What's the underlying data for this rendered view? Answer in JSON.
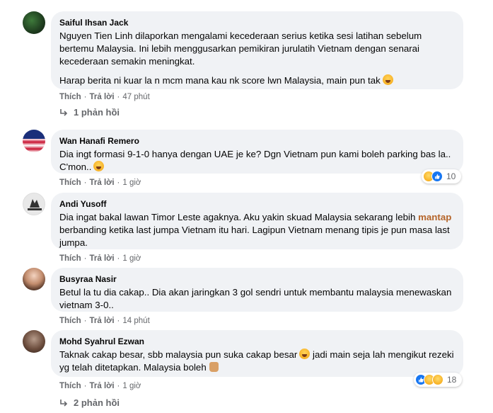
{
  "comments": [
    {
      "author": "Saiful Ihsan Jack",
      "paragraph1": "Nguyen Tien Linh dilaporkan mengalami kecederaan serius ketika sesi latihan sebelum bertemu Malaysia. Ini lebih menggusarkan pemikiran jurulatih Vietnam dengan senarai kecederaan semakin meningkat.",
      "paragraph2": "Harap berita ni kuar la n mcm mana kau nk score lwn Malaysia, main pun tak",
      "like": "Thích",
      "reply": "Trả lời",
      "time": "47 phút",
      "replies": "1 phản hồi"
    },
    {
      "author": "Wan Hanafi Remero",
      "text": "Dia ingt formasi 9-1-0 hanya dengan UAE je ke? Dgn Vietnam pun kami boleh parking bas la.. C'mon..",
      "like": "Thích",
      "reply": "Trả lời",
      "time": "1 giờ",
      "reaction_count": "10"
    },
    {
      "author": "Andi Yusoff",
      "text_before": "Dia ingat bakal lawan Timor Leste agaknya. Aku yakin skuad Malaysia sekarang lebih",
      "highlight": "mantap",
      "text_after": "berbanding ketika last jumpa Vietnam itu hari. Lagipun Vietnam menang tipis je pun masa last jumpa.",
      "like": "Thích",
      "reply": "Trả lời",
      "time": "1 giờ"
    },
    {
      "author": "Busyraa Nasir",
      "text": "Betul la tu dia cakap.. Dia akan jaringkan 3 gol sendri untuk membantu malaysia menewaskan vietnam 3-0..",
      "like": "Thích",
      "reply": "Trả lời",
      "time": "14 phút"
    },
    {
      "author": "Mohd Syahrul Ezwan",
      "text_before": "Taknak cakap besar, sbb malaysia pun suka cakap besar",
      "text_after": "jadi main seja lah mengikut rezeki yg telah ditetapkan. Malaysia boleh",
      "like": "Thích",
      "reply": "Trả lời",
      "time": "1 giờ",
      "reaction_count": "18",
      "replies": "2 phản hồi"
    }
  ],
  "separator": "·",
  "icons": {
    "reply_arrow": "reply-arrow-icon",
    "laugh": "laughing-emoji-icon",
    "thumbs_up": "thumbs-up-emoji-icon"
  },
  "colors": {
    "bubble": "#f0f2f5",
    "meta": "#65676b",
    "highlight": "#b5652a",
    "like_blue": "#1877f2"
  }
}
